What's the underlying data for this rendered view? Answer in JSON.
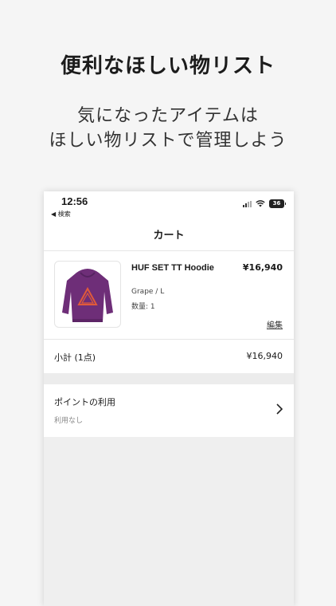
{
  "promo": {
    "title": "便利なほしい物リスト",
    "subtitle_line1": "気になったアイテムは",
    "subtitle_line2": "ほしい物リストで管理しよう"
  },
  "status_bar": {
    "time": "12:56",
    "back_label": "◀ 検索",
    "battery": "36"
  },
  "nav": {
    "title": "カート"
  },
  "cart_item": {
    "name": "HUF SET TT Hoodie",
    "variant": "Grape / L",
    "quantity": "数量: 1",
    "price": "¥16,940",
    "edit_label": "編集",
    "image_icon": "hoodie-image",
    "colors": {
      "hoodie": "#6e2e78",
      "logo": "#e05a3a"
    }
  },
  "subtotal": {
    "label": "小計 (1点)",
    "value": "¥16,940"
  },
  "points": {
    "label": "ポイントの利用",
    "value": "利用なし",
    "icon": "chevron-right-icon"
  }
}
